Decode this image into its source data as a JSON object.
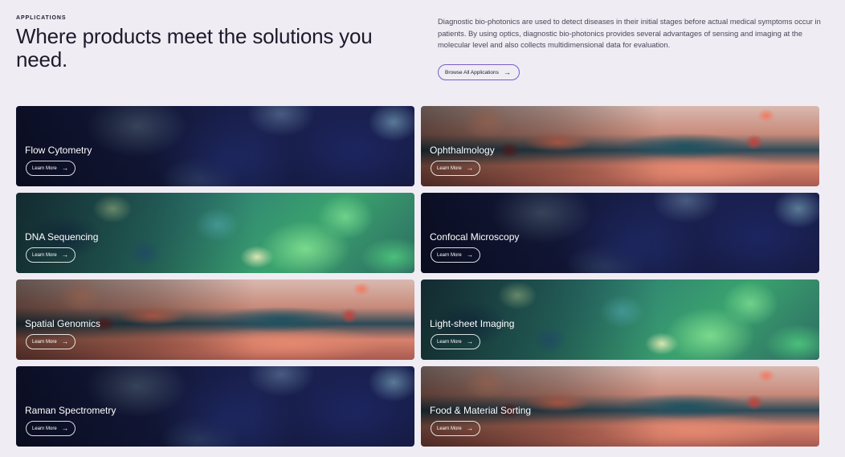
{
  "header": {
    "eyebrow": "APPLICATIONS",
    "headline": "Where products meet the solutions you need.",
    "intro": "Diagnostic bio-photonics are used to detect diseases in their initial stages before actual medical symptoms occur in patients. By using optics, diagnostic bio-photonics provides several advantages of sensing and imaging at the molecular level and also collects multidimensional data for evaluation.",
    "browse_label": "Browse All Applications",
    "arrow": "→"
  },
  "cards": [
    {
      "title": "Flow Cytometry",
      "cta": "Learn More",
      "arrow": "→",
      "texture": "cells"
    },
    {
      "title": "Ophthalmology",
      "cta": "Learn More",
      "arrow": "→",
      "texture": "swirl"
    },
    {
      "title": "DNA Sequencing",
      "cta": "Learn More",
      "arrow": "→",
      "texture": "marble"
    },
    {
      "title": "Confocal Microscopy",
      "cta": "Learn More",
      "arrow": "→",
      "texture": "cells"
    },
    {
      "title": "Spatial Genomics",
      "cta": "Learn More",
      "arrow": "→",
      "texture": "swirl"
    },
    {
      "title": "Light-sheet Imaging",
      "cta": "Learn More",
      "arrow": "→",
      "texture": "marble"
    },
    {
      "title": "Raman Spectrometry",
      "cta": "Learn More",
      "arrow": "→",
      "texture": "cells"
    },
    {
      "title": "Food & Material Sorting",
      "cta": "Learn More",
      "arrow": "→",
      "texture": "swirl"
    }
  ],
  "colors": {
    "background": "#f0ecf4",
    "text": "#1d1a2b",
    "accent_border": "#7a5cc6"
  }
}
